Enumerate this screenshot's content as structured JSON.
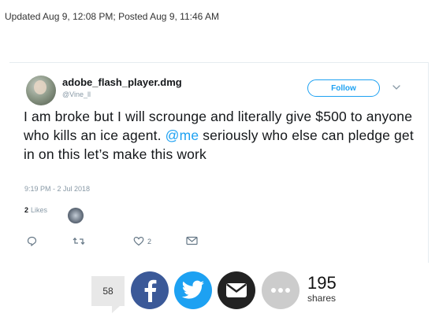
{
  "article": {
    "dateline": "Updated Aug 9, 12:08 PM; Posted Aug 9, 11:46 AM"
  },
  "tweet": {
    "display_name": "adobe_flash_player.dmg",
    "handle": "@Vine_ll",
    "follow_label": "Follow",
    "text_part1": "I am broke but I will scrounge and literally give $500 to anyone who kills an ice agent. ",
    "mention": "@me",
    "text_part2": " seriously who else can pledge get in on this let’s make this work",
    "timestamp": "9:19 PM - 2 Jul 2018",
    "likes_count": "2",
    "likes_label": "Likes",
    "actions": {
      "reply_icon": "reply-icon",
      "retweet_icon": "retweet-icon",
      "like_icon": "heart-icon",
      "like_count": "2",
      "dm_icon": "envelope-icon"
    },
    "colors": {
      "accent": "#1da1f2",
      "muted": "#8899a6"
    }
  },
  "share_bar": {
    "comment_count": "58",
    "buttons": [
      {
        "name": "facebook",
        "icon": "facebook-icon",
        "color": "#3b5998"
      },
      {
        "name": "twitter",
        "icon": "twitter-icon",
        "color": "#1da1f2"
      },
      {
        "name": "email",
        "icon": "envelope-icon",
        "color": "#222222"
      },
      {
        "name": "more",
        "icon": "more-icon",
        "color": "#cccccc"
      }
    ],
    "shares_count": "195",
    "shares_label": "shares"
  }
}
